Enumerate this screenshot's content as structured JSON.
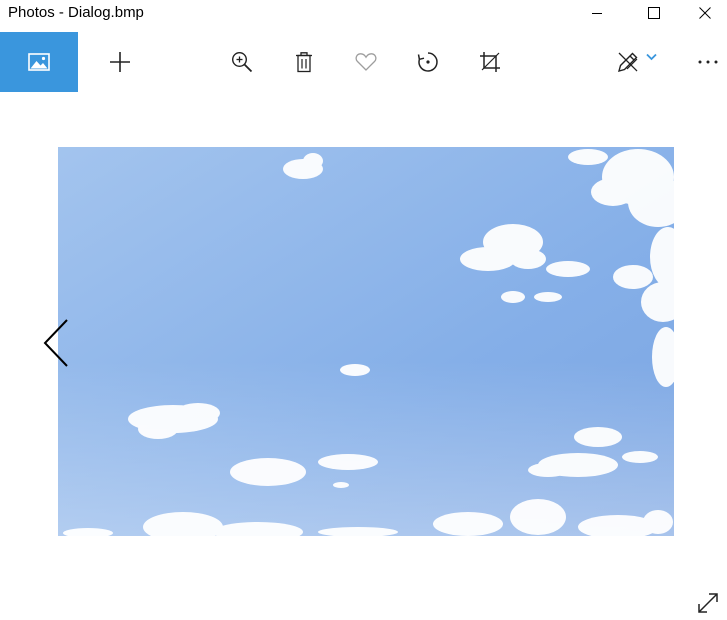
{
  "window": {
    "title": "Photos - Dialog.bmp"
  },
  "toolbar": {
    "collection_icon": "image-icon",
    "add_icon": "plus-icon",
    "zoom_icon": "zoom-in-icon",
    "delete_icon": "trash-icon",
    "favorite_icon": "heart-icon",
    "rotate_icon": "rotate-icon",
    "crop_icon": "crop-icon",
    "edit_icon": "edit-create-icon",
    "more_icon": "more-icon"
  },
  "colors": {
    "accent": "#3a96dd",
    "sky_top": "#8fb7ea",
    "sky_bottom": "#b9d4f3"
  }
}
